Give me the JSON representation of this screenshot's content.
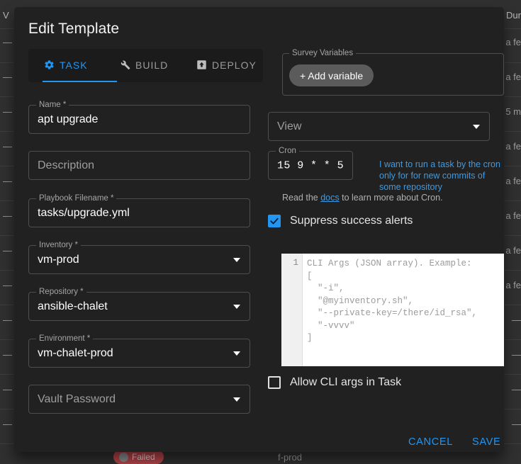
{
  "background": {
    "header_left": "V",
    "header_right": "Dur",
    "rows": [
      {
        "left": "—",
        "right": "a fe"
      },
      {
        "left": "—",
        "right": "a fe"
      },
      {
        "left": "—",
        "right": "5 m"
      },
      {
        "left": "—",
        "right": "a fe"
      },
      {
        "left": "—",
        "right": "a fe"
      },
      {
        "left": "—",
        "right": "a fe"
      },
      {
        "left": "—",
        "right": "a fe"
      },
      {
        "left": "—",
        "right": "a fe"
      },
      {
        "left": "—",
        "right": "—"
      },
      {
        "left": "—",
        "right": "—"
      },
      {
        "left": "—",
        "right": "—"
      },
      {
        "left": "—",
        "right": "—"
      }
    ],
    "status_badge": "Failed",
    "env_cell": "f-prod"
  },
  "dialog": {
    "title": "Edit Template",
    "tabs": [
      {
        "label": "TASK",
        "icon": "gear-icon",
        "active": true
      },
      {
        "label": "BUILD",
        "icon": "wrench-icon",
        "active": false
      },
      {
        "label": "DEPLOY",
        "icon": "upload-box-icon",
        "active": false
      }
    ],
    "fields": {
      "name": {
        "label": "Name *",
        "value": "apt upgrade"
      },
      "description": {
        "label": "",
        "placeholder": "Description"
      },
      "playbook": {
        "label": "Playbook Filename *",
        "value": "tasks/upgrade.yml"
      },
      "inventory": {
        "label": "Inventory *",
        "value": "vm-prod"
      },
      "repository": {
        "label": "Repository *",
        "value": "ansible-chalet"
      },
      "environment": {
        "label": "Environment *",
        "value": "vm-chalet-prod"
      },
      "vault": {
        "label": "",
        "placeholder": "Vault Password"
      },
      "view": {
        "label": "",
        "placeholder": "View"
      },
      "cron": {
        "label": "Cron",
        "value": "15 9 * * 5"
      }
    },
    "survey": {
      "legend": "Survey Variables",
      "add_button": "+ Add variable"
    },
    "cron_help": {
      "link_text": "I want to run a task by the cron only for for new commits of some repository",
      "docs_prefix": "Read the ",
      "docs_link": "docs",
      "docs_suffix": " to learn more about Cron."
    },
    "checkboxes": {
      "suppress_alerts": {
        "label": "Suppress success alerts",
        "checked": true
      },
      "allow_cli_args": {
        "label": "Allow CLI args in Task",
        "checked": false
      }
    },
    "cli_editor": {
      "line_number": "1",
      "content": "CLI Args (JSON array). Example:\n[\n  \"-i\",\n  \"@myinventory.sh\",\n  \"--private-key=/there/id_rsa\",\n  \"-vvvv\"\n]"
    },
    "actions": {
      "cancel": "CANCEL",
      "save": "SAVE"
    }
  },
  "colors": {
    "accent": "#2196f3",
    "dialog_bg": "#212121",
    "page_bg": "#303030",
    "field_border": "#4e4e4e",
    "danger": "#b5454a"
  }
}
